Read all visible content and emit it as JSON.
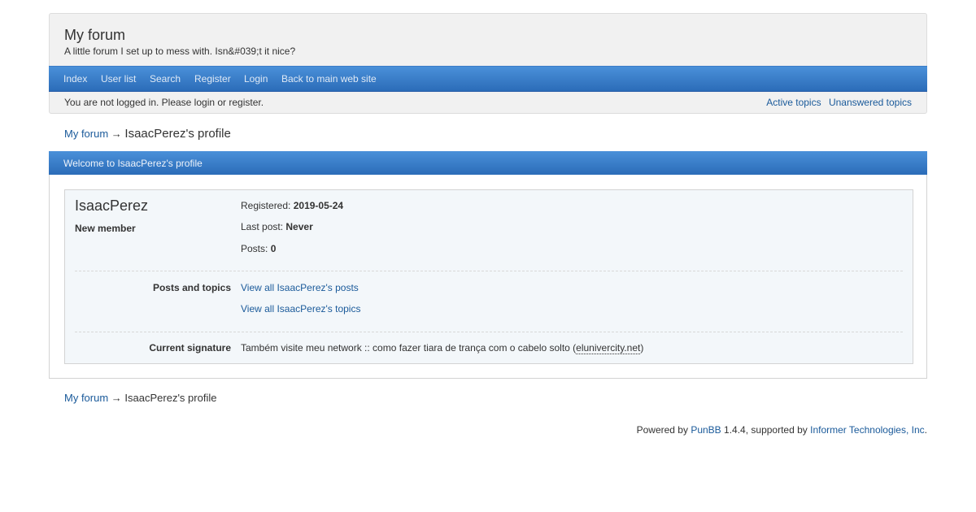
{
  "header": {
    "title": "My forum",
    "description": "A little forum I set up to mess with. Isn&#039;t it nice?"
  },
  "nav": {
    "items": [
      "Index",
      "User list",
      "Search",
      "Register",
      "Login",
      "Back to main web site"
    ]
  },
  "status": {
    "message": "You are not logged in. Please login or register.",
    "active_topics": "Active topics",
    "unanswered_topics": "Unanswered topics"
  },
  "breadcrumb": {
    "root": "My forum",
    "arrow": "→",
    "current": "IsaacPerez's profile"
  },
  "profile": {
    "heading": "Welcome to IsaacPerez's profile",
    "username": "IsaacPerez",
    "user_title": "New member",
    "registered_label": "Registered:",
    "registered_value": "2019-05-24",
    "last_post_label": "Last post:",
    "last_post_value": "Never",
    "posts_label": "Posts:",
    "posts_value": "0",
    "posts_topics_label": "Posts and topics",
    "view_posts": "View all IsaacPerez's posts",
    "view_topics": "View all IsaacPerez's topics",
    "signature_label": "Current signature",
    "signature_text": "Também visite meu network :: como fazer tiara de trança com o cabelo solto (",
    "signature_link": "elunivercity.net",
    "signature_end": ")"
  },
  "footer": {
    "powered_by": "Powered by",
    "punbb": "PunBB",
    "version_text": "1.4.4, supported by",
    "company": "Informer Technologies, Inc",
    "period": "."
  }
}
